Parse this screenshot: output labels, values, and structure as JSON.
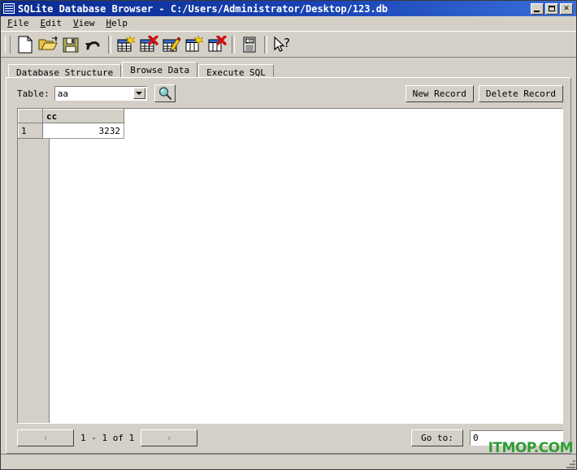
{
  "window": {
    "title": "SQLite Database Browser - C:/Users/Administrator/Desktop/123.db",
    "icon": "database-lines-icon",
    "minimize_label": "",
    "maximize_label": "",
    "close_label": "✕"
  },
  "menubar": {
    "items": [
      {
        "label": "File",
        "mnemonic": "F",
        "rest": "ile"
      },
      {
        "label": "Edit",
        "mnemonic": "E",
        "rest": "dit"
      },
      {
        "label": "View",
        "mnemonic": "V",
        "rest": "iew"
      },
      {
        "label": "Help",
        "mnemonic": "H",
        "rest": "elp"
      }
    ]
  },
  "toolbar": {
    "buttons": [
      {
        "name": "new-database-icon",
        "tooltip": "New Database"
      },
      {
        "name": "open-database-icon",
        "tooltip": "Open Database"
      },
      {
        "name": "save-database-icon",
        "tooltip": "Write Changes"
      },
      {
        "name": "revert-changes-icon",
        "tooltip": "Revert Changes"
      },
      {
        "name": "create-table-icon",
        "tooltip": "Create Table"
      },
      {
        "name": "delete-table-icon",
        "tooltip": "Delete Table"
      },
      {
        "name": "modify-table-icon",
        "tooltip": "Modify Table"
      },
      {
        "name": "create-index-icon",
        "tooltip": "Create Index"
      },
      {
        "name": "delete-index-icon",
        "tooltip": "Delete Index"
      },
      {
        "name": "log-icon",
        "tooltip": "Show SQL Log"
      },
      {
        "name": "whats-this-icon",
        "tooltip": "What's This?"
      }
    ]
  },
  "tabs": [
    {
      "label": "Database Structure",
      "active": false
    },
    {
      "label": "Browse Data",
      "active": true
    },
    {
      "label": "Execute SQL",
      "active": false
    }
  ],
  "browse": {
    "table_label": "Table:",
    "table_value": "aa",
    "search_icon": "magnifier-icon",
    "new_record_label": "New Record",
    "delete_record_label": "Delete Record",
    "grid": {
      "columns": [
        "cc"
      ],
      "rows": [
        {
          "row_number": "1",
          "values": [
            "3232"
          ]
        }
      ]
    },
    "prev_label": "‹",
    "next_label": "›",
    "page_info": "1 - 1 of 1",
    "goto_label": "Go to:",
    "goto_value": "0"
  },
  "watermark": {
    "text": "ITMOP.COM",
    "color": "#2e9e34"
  },
  "colors": {
    "face": "#d4d0c8",
    "title_start": "#0a2a8f",
    "title_end": "#3a6fd8",
    "field": "#ffffff"
  }
}
